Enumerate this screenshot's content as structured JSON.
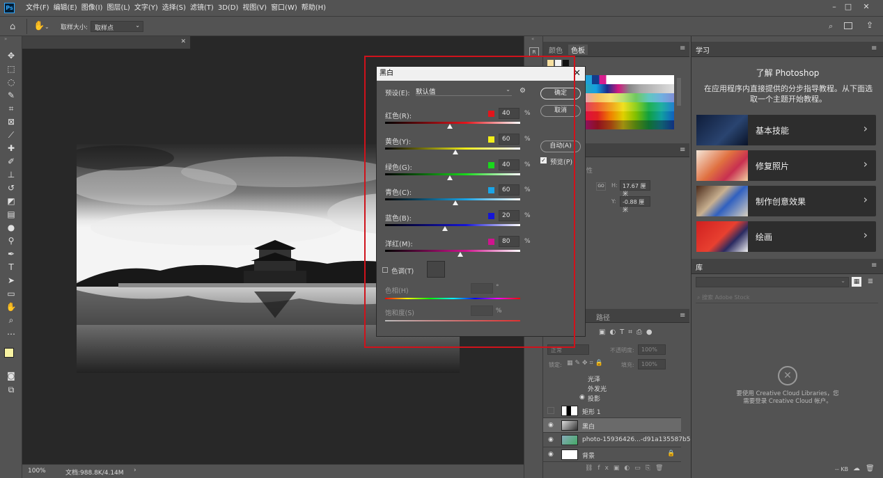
{
  "app": {
    "logo": "Ps"
  },
  "menu": [
    "文件(F)",
    "编辑(E)",
    "图像(I)",
    "图层(L)",
    "文字(Y)",
    "选择(S)",
    "滤镜(T)",
    "3D(D)",
    "视图(V)",
    "窗口(W)",
    "帮助(H)"
  ],
  "options": {
    "sample_label": "取样大小:",
    "sample_value": "取样点"
  },
  "status": {
    "zoom": "100%",
    "doc": "文档:988.8K/4.14M"
  },
  "color_panel": {
    "tab1": "颜色",
    "tab2": "色板"
  },
  "properties": {
    "w_label": "H:",
    "w_value": "17.67 厘米",
    "y_label": "Y:",
    "y_value": "-0.88 厘米",
    "go": "GO"
  },
  "layers_panel": {
    "tab": "路径",
    "mode": "正常",
    "opacity_label": "不透明度:",
    "opacity": "100%",
    "lock_label": "锁定:",
    "fill_label": "填充:",
    "fill": "100%",
    "effects": [
      "光泽",
      "外发光",
      "投影"
    ],
    "layers": [
      {
        "name": "矩形 1",
        "visible": false
      },
      {
        "name": "黑白",
        "visible": true,
        "selected": true
      },
      {
        "name": "photo-15936426...-d91a135587b5",
        "visible": true
      },
      {
        "name": "背景",
        "visible": true
      }
    ]
  },
  "learn": {
    "tab": "学习",
    "title": "了解 Photoshop",
    "subtitle": "在应用程序内直接提供的分步指导教程。从下面选取一个主题开始教程。",
    "cards": [
      "基本技能",
      "修复照片",
      "制作创意效果",
      "绘画"
    ]
  },
  "library": {
    "tab": "库",
    "search": "搜索 Adobe Stock",
    "msg1": "要使用 Creative Cloud Libraries，您",
    "msg2": "需要登录 Creative Cloud 帐户。",
    "kb": "-- KB"
  },
  "dialog": {
    "title": "黑白",
    "preset_label": "预设(E):",
    "preset_value": "默认值",
    "ok": "确定",
    "cancel": "取消",
    "auto": "自动(A)",
    "preview": "预览(P)",
    "tint_label": "色调(T)",
    "hue_label": "色相(H)",
    "hue_unit": "°",
    "sat_label": "饱和度(S)",
    "sat_unit": "%",
    "sliders": [
      {
        "label": "红色(R):",
        "value": "40",
        "pct": "%",
        "color": "#e3141b"
      },
      {
        "label": "黄色(Y):",
        "value": "60",
        "pct": "%",
        "color": "#f2ee1a"
      },
      {
        "label": "绿色(G):",
        "value": "40",
        "pct": "%",
        "color": "#19d81c"
      },
      {
        "label": "青色(C):",
        "value": "60",
        "pct": "%",
        "color": "#1aa4e6"
      },
      {
        "label": "蓝色(B):",
        "value": "20",
        "pct": "%",
        "color": "#1515d6"
      },
      {
        "label": "洋红(M):",
        "value": "80",
        "pct": "%",
        "color": "#d0148e"
      }
    ]
  },
  "colors": {
    "highlight": "#d0121b",
    "accent": "#31a8ff"
  }
}
